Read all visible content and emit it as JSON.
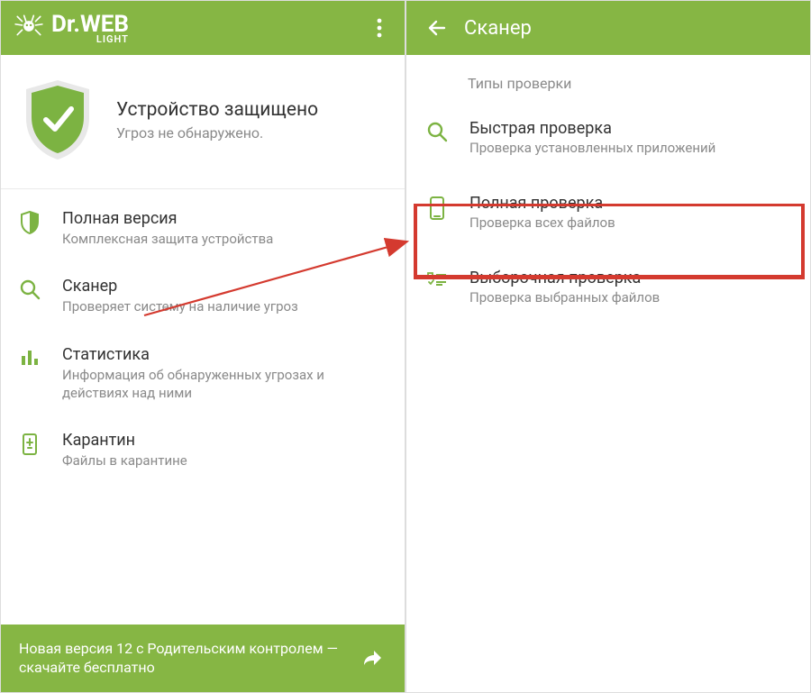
{
  "colors": {
    "brand_green": "#86b644",
    "shield_green": "#7cb342",
    "text_primary": "#333333",
    "text_secondary": "#8a8a8a",
    "highlight_red": "#d43a2f"
  },
  "left": {
    "logo_main": "Dr.WEB",
    "logo_sub": "LIGHT",
    "status": {
      "title": "Устройство защищено",
      "subtitle": "Угроз не обнаружено."
    },
    "menu": [
      {
        "icon": "shield-outline-icon",
        "title": "Полная версия",
        "subtitle": "Комплексная защита устройства"
      },
      {
        "icon": "search-icon",
        "title": "Сканер",
        "subtitle": "Проверяет систему на наличие угроз"
      },
      {
        "icon": "stats-icon",
        "title": "Статистика",
        "subtitle": "Информация об обнаруженных угрозах и действиях над ними"
      },
      {
        "icon": "quarantine-icon",
        "title": "Карантин",
        "subtitle": "Файлы в карантине"
      }
    ],
    "promo": "Новая версия 12 с Родительским контролем — скачайте бесплатно"
  },
  "right": {
    "title": "Сканер",
    "section_header": "Типы проверки",
    "items": [
      {
        "icon": "search-icon",
        "title": "Быстрая проверка",
        "subtitle": "Проверка установленных приложений"
      },
      {
        "icon": "phone-icon",
        "title": "Полная проверка",
        "subtitle": "Проверка всех файлов"
      },
      {
        "icon": "checklist-icon",
        "title": "Выборочная проверка",
        "subtitle": "Проверка выбранных файлов"
      }
    ]
  }
}
